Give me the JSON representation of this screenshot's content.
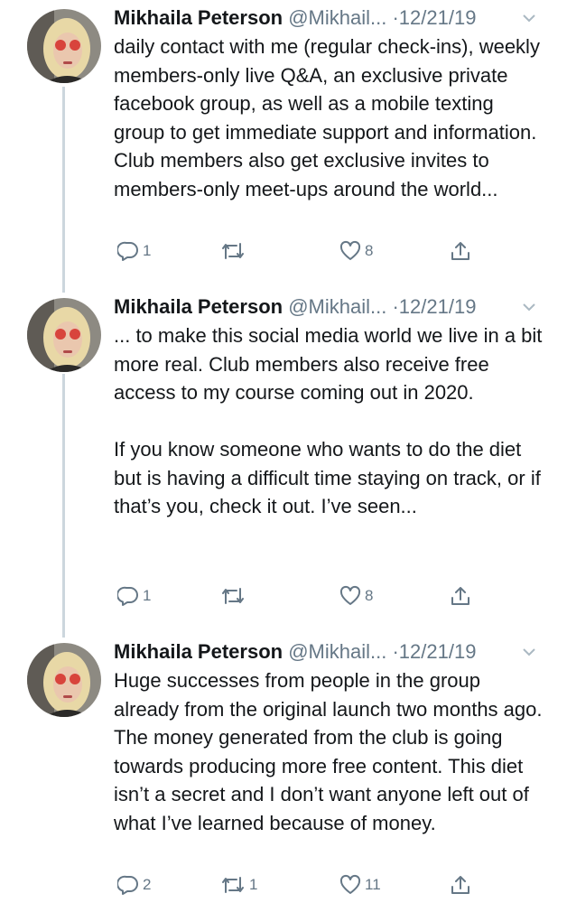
{
  "tweets": [
    {
      "name": "Mikhaila Peterson",
      "handle": "@Mikhail...",
      "date": "·12/21/19",
      "text": "daily contact with me (regular check-ins), weekly members-only live Q&A, an exclusive private facebook group, as well as a mobile texting group to get immediate support and information. Club members also get exclusive invites to members-only meet-ups around the world...",
      "replies": "1",
      "retweets": "",
      "likes": "8"
    },
    {
      "name": "Mikhaila Peterson",
      "handle": "@Mikhail...",
      "date": "·12/21/19",
      "text": "... to make this social media world we live in a bit more real. Club members also receive free access to my course coming out in 2020.\n\nIf you know someone who wants to do the diet but is having a difficult time staying on track, or if that’s you, check it out. I’ve seen...",
      "replies": "1",
      "retweets": "",
      "likes": "8"
    },
    {
      "name": "Mikhaila Peterson",
      "handle": "@Mikhail...",
      "date": "·12/21/19",
      "text": "Huge successes from people in the group already from the original launch two months ago. The money generated from the club is going towards producing more free content. This diet isn’t a secret and I don’t want anyone left out of what I’ve learned because of money.",
      "replies": "2",
      "retweets": "1",
      "likes": "11"
    }
  ],
  "icons": {
    "reply": "reply-icon",
    "retweet": "retweet-icon",
    "like": "heart-icon",
    "share": "share-icon",
    "menu": "chevron-down-icon"
  },
  "colors": {
    "name": "#14171a",
    "meta": "#657786",
    "thread_line": "#ccd6dd"
  }
}
